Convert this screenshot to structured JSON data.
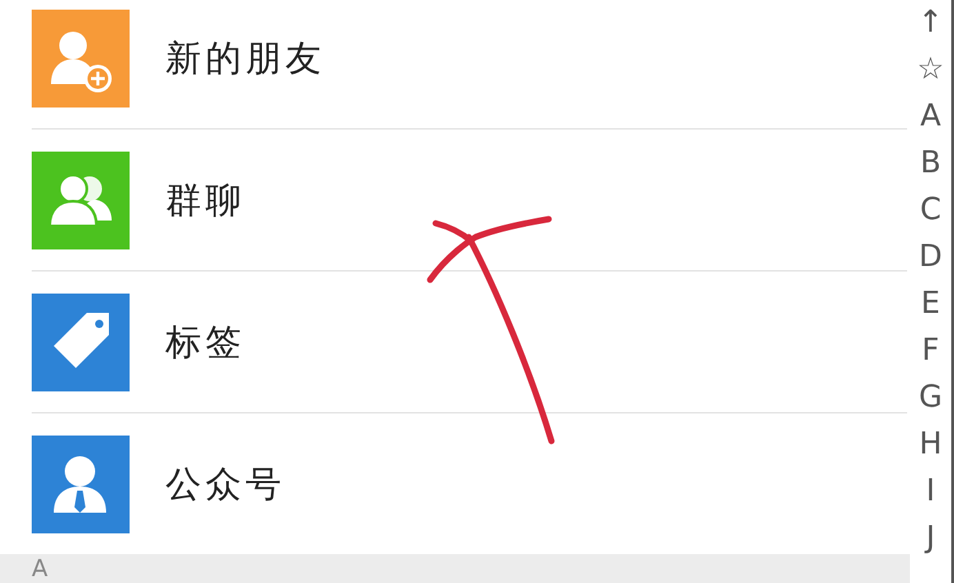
{
  "entries": [
    {
      "label": "新的朋友",
      "kind": "new-friend",
      "color": "#f79a38"
    },
    {
      "label": "群聊",
      "kind": "group",
      "color": "#4cc21f"
    },
    {
      "label": "标签",
      "kind": "tag",
      "color": "#2d83d6"
    },
    {
      "label": "公众号",
      "kind": "official",
      "color": "#2d83d6"
    }
  ],
  "section_header": "A",
  "index": [
    "↑",
    "☆",
    "A",
    "B",
    "C",
    "D",
    "E",
    "F",
    "G",
    "H",
    "I",
    "J"
  ],
  "annotation": {
    "kind": "arrow"
  }
}
